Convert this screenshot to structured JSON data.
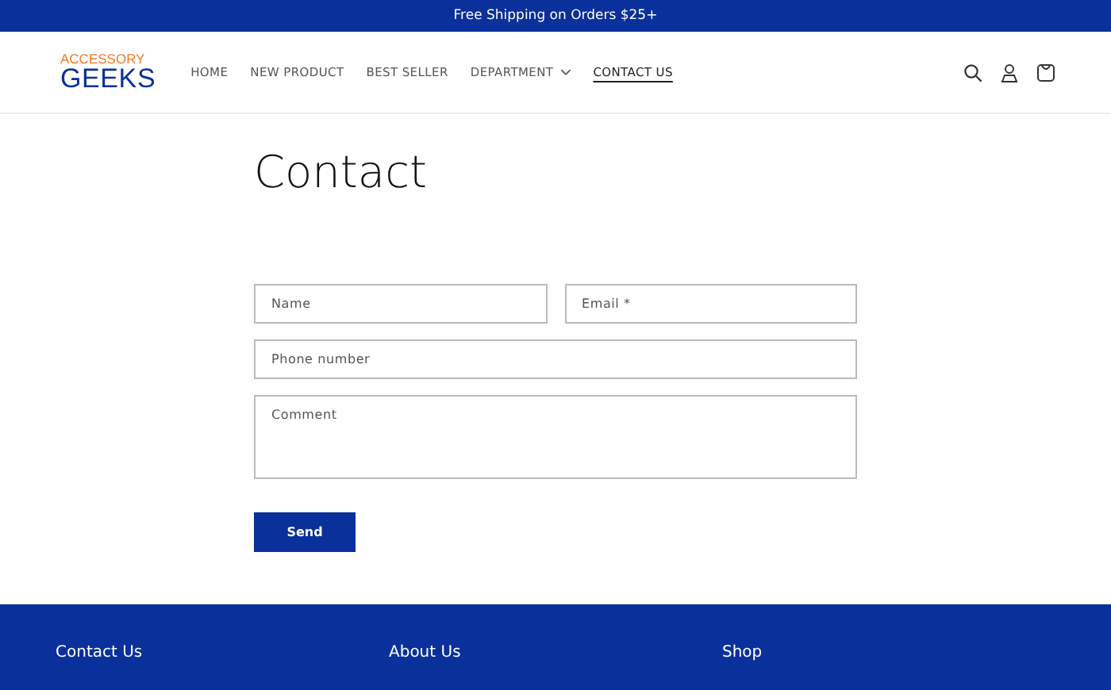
{
  "announcement": "Free Shipping on Orders $25+",
  "logo": {
    "top": "ACCESSORY",
    "bottom": "GEEKS"
  },
  "nav": [
    {
      "label": "HOME",
      "selected": false,
      "dropdown": false
    },
    {
      "label": "NEW PRODUCT",
      "selected": false,
      "dropdown": false
    },
    {
      "label": "BEST SELLER",
      "selected": false,
      "dropdown": false
    },
    {
      "label": "DEPARTMENT",
      "selected": false,
      "dropdown": true
    },
    {
      "label": "CONTACT US",
      "selected": true,
      "dropdown": false
    }
  ],
  "heading": "Contact",
  "form": {
    "name": {
      "placeholder": "Name"
    },
    "email": {
      "placeholder": "Email *"
    },
    "phone": {
      "placeholder": "Phone number"
    },
    "comment": {
      "placeholder": "Comment"
    },
    "submit": "Send"
  },
  "footer": {
    "columns": [
      {
        "title": "Contact Us"
      },
      {
        "title": "About Us"
      },
      {
        "title": "Shop"
      }
    ]
  }
}
